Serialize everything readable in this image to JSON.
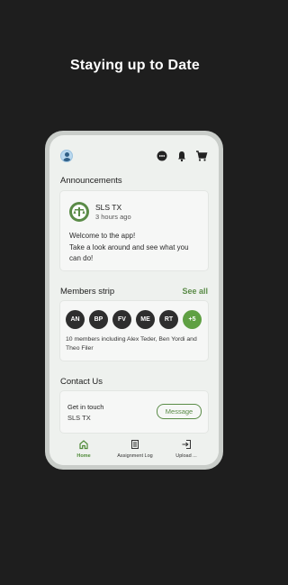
{
  "headline": "Staying up to Date",
  "announcements": {
    "title": "Announcements",
    "org": "SLS TX",
    "time": "3 hours ago",
    "message": "Welcome to the app!\nTake a look around and see what you can do!"
  },
  "members": {
    "title": "Members strip",
    "see_all": "See all",
    "initials": [
      "AN",
      "BP",
      "FV",
      "ME",
      "RT"
    ],
    "more": "+5",
    "summary": "10 members including Alex Teder, Ben Yordi and Theo Filer"
  },
  "contact": {
    "title": "Contact Us",
    "label": "Get in touch",
    "org": "SLS TX",
    "button": "Message"
  },
  "nav": {
    "home": "Home",
    "assignment": "Assignment Log",
    "upload": "Upload ..."
  },
  "colors": {
    "accent": "#5fa043",
    "background": "#1e1e1e",
    "screen": "#eef1ee"
  },
  "icons": [
    "avatar",
    "chat-icon",
    "bell-icon",
    "cart-icon",
    "home-icon",
    "assignment-icon",
    "upload-icon"
  ]
}
